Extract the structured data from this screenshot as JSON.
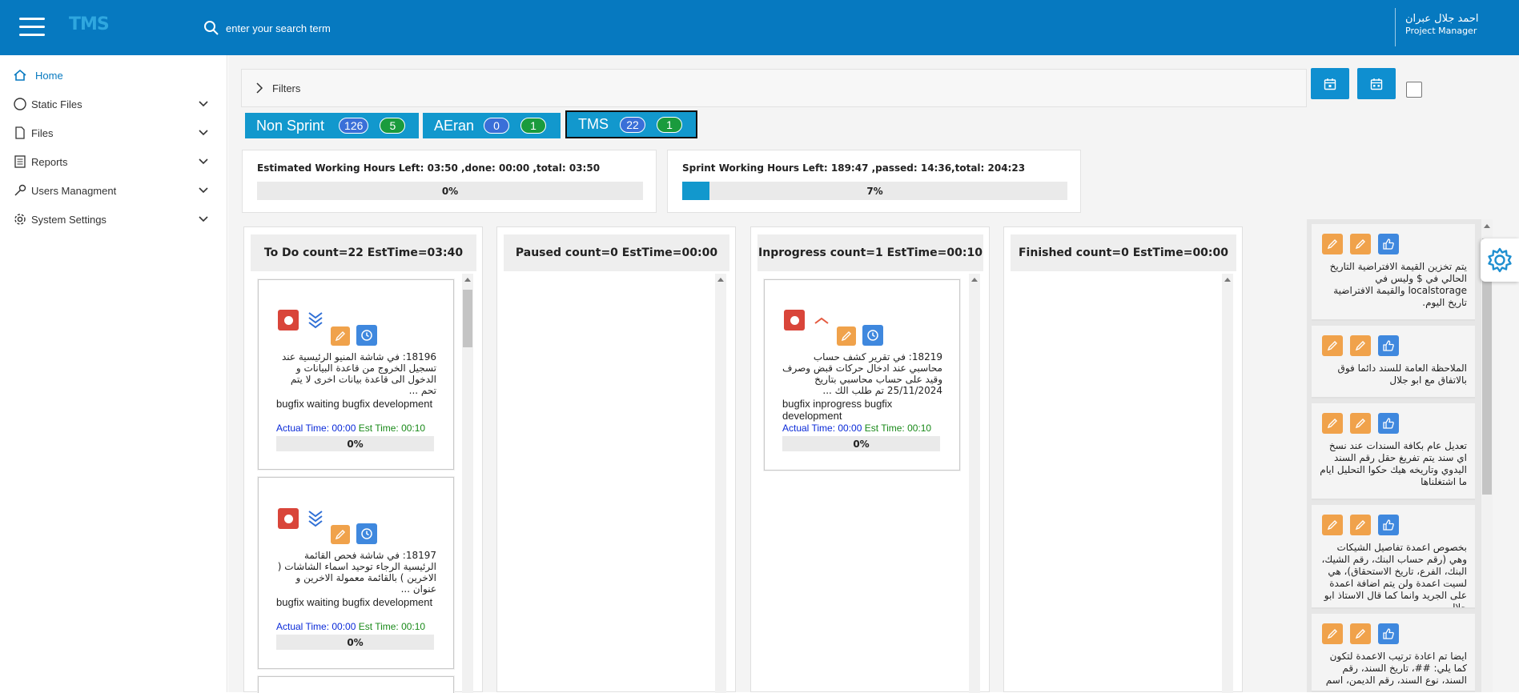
{
  "header": {
    "logo": "TMS",
    "search_placeholder": "enter your search term",
    "user_name": "احمد جلال عبران",
    "user_role": "Project Manager"
  },
  "sidebar": {
    "items": [
      {
        "label": "Home",
        "icon": "home-icon",
        "active": true
      },
      {
        "label": "Static Files",
        "icon": "circle-icon",
        "expandable": true
      },
      {
        "label": "Files",
        "icon": "file-icon",
        "expandable": true
      },
      {
        "label": "Reports",
        "icon": "report-icon",
        "expandable": true
      },
      {
        "label": "Users Managment",
        "icon": "key-icon",
        "expandable": true
      },
      {
        "label": "System Settings",
        "icon": "gear-icon",
        "expandable": true
      }
    ]
  },
  "filters": {
    "label": "Filters"
  },
  "sprints": [
    {
      "name": "Non Sprint",
      "count_blue": "126",
      "count_green": "5",
      "active": false
    },
    {
      "name": "AEran",
      "count_blue": "0",
      "count_green": "1",
      "active": false
    },
    {
      "name": "TMS",
      "count_blue": "22",
      "count_green": "1",
      "active": true
    }
  ],
  "estimated_hours": {
    "title": "Estimated Working Hours Left: 03:50 ,done: 00:00 ,total: 03:50",
    "progress": 0,
    "progress_text": "0%"
  },
  "sprint_hours": {
    "title": "Sprint Working Hours Left: 189:47 ,passed: 14:36,total: 204:23",
    "progress": 7,
    "progress_text": "7%"
  },
  "columns": [
    {
      "title": "To Do count=22 EstTime=03:40"
    },
    {
      "title": "Paused count=0 EstTime=00:00"
    },
    {
      "title": "Inprogress count=1 EstTime=00:10"
    },
    {
      "title": "Finished count=0 EstTime=00:00"
    }
  ],
  "tasks": {
    "todo": [
      {
        "priority": "low",
        "description": "18196: في شاشة المنيو الرئيسية عند تسجيل الخروج من قاعدة البيانات و الدخول الى قاعدة بيانات اخرى لا يتم تحم ...",
        "status": "bugfix waiting bugfix development",
        "actual_time": "Actual Time: 00:00",
        "est_time": "Est Time: 00:10",
        "progress": "0%"
      },
      {
        "priority": "low",
        "description": "18197: في شاشة فحص القائمة الرئيسية الرجاء توحيد اسماء الشاشات ( الاخرين ) بالقائمة معمولة الاخرين و عنوان ...",
        "status": "bugfix waiting bugfix development",
        "actual_time": "Actual Time: 00:00",
        "est_time": "Est Time: 00:10",
        "progress": "0%"
      }
    ],
    "inprogress": [
      {
        "priority": "high",
        "description": "18219: في تقرير كشف حساب محاسبي عند ادخال حركات قبض وصرف وقيد على حساب محاسبي بتاريخ 25/11/2024 تم طلب الك ...",
        "status": "bugfix inprogress bugfix development",
        "actual_time": "Actual Time: 00:00",
        "est_time": "Est Time: 00:10",
        "progress": "0%"
      }
    ]
  },
  "notes": [
    "يتم تخزين القيمة الافتراضية التاريخ الحالي في $ وليس في localstorage والقيمة الافتراضية تاريخ اليوم.",
    "الملاحظة العامة للسند دائما فوق بالاتفاق مع ابو جلال",
    "تعديل عام بكافة السندات عند نسخ اي سند يتم تفريغ حقل رقم السند اليدوي وتاريخه هيك حكوا التحليل ايام ما اشتغلناها",
    "بخصوص اعمدة تفاصيل الشيكات وهي (رقم حساب البنك، رقم الشيك، البنك، الفرع، تاريخ الاستحقاق)، هي لسيت اعمدة ولن يتم اضافة اعمدة على الجريد وانما كما قال الاستاذ ابو جلال",
    "ايضا تم اعادة ترتيب الاعمدة لتكون كما يلي: ##، تاريخ السند، رقم السند، نوع السند، رقم الديمن، اسم"
  ],
  "colors": {
    "brand": "#0679c0",
    "tab": "#1298cd",
    "stop": "#d9453a",
    "edit": "#f0a24b",
    "action_blue": "#3f88de"
  }
}
